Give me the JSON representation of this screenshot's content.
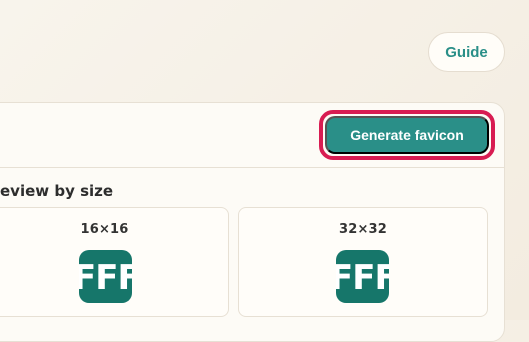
{
  "header": {
    "guide_label": "Guide"
  },
  "toolbar": {
    "generate_label": "Generate favicon"
  },
  "preview": {
    "title": "eview by size",
    "cards": [
      {
        "label": "16×16",
        "favicon_text": "FFF"
      },
      {
        "label": "32×32",
        "favicon_text": "FFF"
      }
    ]
  },
  "colors": {
    "accent": "#2a8f88",
    "highlight": "#d81c52",
    "favicon_bg": "#16766a",
    "background": "#f8f4ec"
  },
  "icons": {
    "favicon_preview": "favicon-preview-icon"
  }
}
